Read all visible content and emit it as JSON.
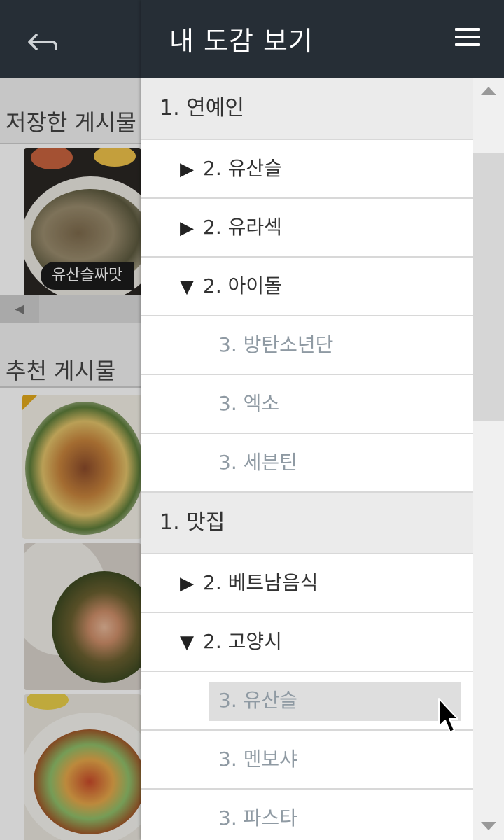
{
  "colors": {
    "topbar": "#262e36",
    "level1_row_bg": "#ebebeb",
    "level3_text": "#8f9aa3",
    "selected_row_bg": "#dedede"
  },
  "background": {
    "back_icon": "back-arrow-icon",
    "saved_section_title": "저장한 게시물",
    "saved_caption": "유산슬짜맛",
    "recommended_section_title": "추천 게시물"
  },
  "drawer": {
    "title": "내 도감 보기",
    "menu_icon": "hamburger-menu-icon",
    "items": [
      {
        "level": 1,
        "label": "1. 연예인"
      },
      {
        "level": 2,
        "label": "2. 유산슬",
        "expanded": false
      },
      {
        "level": 2,
        "label": "2. 유라섹",
        "expanded": false
      },
      {
        "level": 2,
        "label": "2. 아이돌",
        "expanded": true
      },
      {
        "level": 3,
        "label": "3. 방탄소년단"
      },
      {
        "level": 3,
        "label": "3. 엑소"
      },
      {
        "level": 3,
        "label": "3. 세븐틴"
      },
      {
        "level": 1,
        "label": "1. 맛집"
      },
      {
        "level": 2,
        "label": "2. 베트남음식",
        "expanded": false
      },
      {
        "level": 2,
        "label": "2. 고양시",
        "expanded": true
      },
      {
        "level": 3,
        "label": "3. 유산슬",
        "selected": true
      },
      {
        "level": 3,
        "label": "3. 멘보샤"
      },
      {
        "level": 3,
        "label": "3. 파스타"
      }
    ],
    "collapsed_glyph": "▶",
    "expanded_glyph": "▼"
  }
}
